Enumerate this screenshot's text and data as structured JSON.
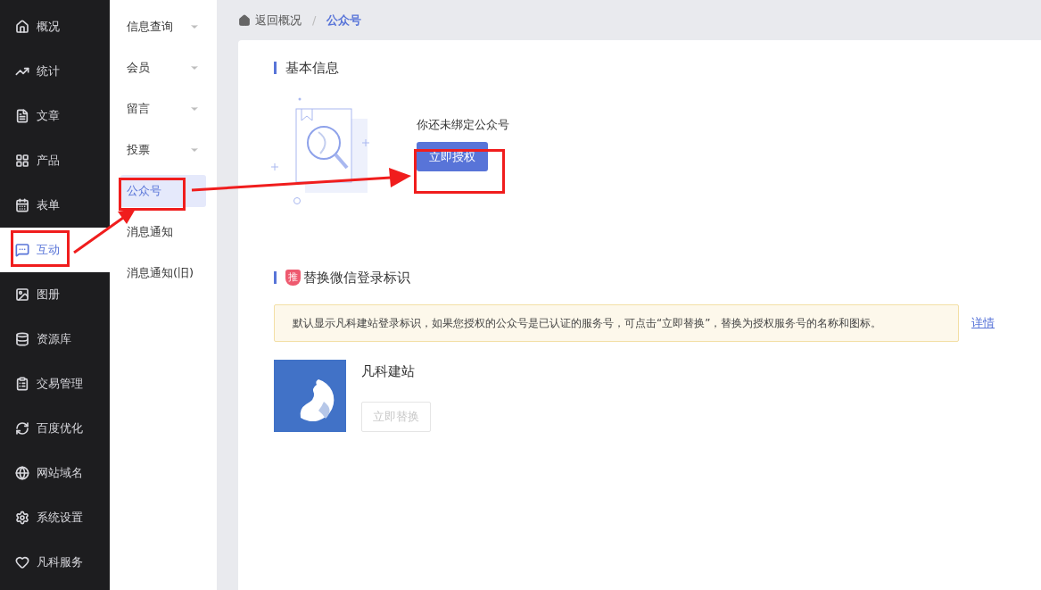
{
  "main_nav": [
    {
      "label": "概况",
      "selected": false
    },
    {
      "label": "统计",
      "selected": false
    },
    {
      "label": "文章",
      "selected": false
    },
    {
      "label": "产品",
      "selected": false
    },
    {
      "label": "表单",
      "selected": false
    },
    {
      "label": "互动",
      "selected": true
    },
    {
      "label": "图册",
      "selected": false
    },
    {
      "label": "资源库",
      "selected": false
    },
    {
      "label": "交易管理",
      "selected": false
    },
    {
      "label": "百度优化",
      "selected": false
    },
    {
      "label": "网站域名",
      "selected": false
    },
    {
      "label": "系统设置",
      "selected": false
    },
    {
      "label": "凡科服务",
      "selected": false
    }
  ],
  "sub_nav": [
    {
      "label": "信息查询",
      "expandable": true,
      "selected": false
    },
    {
      "label": "会员",
      "expandable": true,
      "selected": false
    },
    {
      "label": "留言",
      "expandable": true,
      "selected": false
    },
    {
      "label": "投票",
      "expandable": true,
      "selected": false
    },
    {
      "label": "公众号",
      "expandable": false,
      "selected": true
    },
    {
      "label": "消息通知",
      "expandable": false,
      "selected": false
    },
    {
      "label": "消息通知(旧)",
      "expandable": false,
      "selected": false
    }
  ],
  "breadcrumb": {
    "back": "返回概况",
    "separator": "/",
    "current": "公众号"
  },
  "basic_info": {
    "title": "基本信息",
    "message": "你还未绑定公众号",
    "button": "立即授权"
  },
  "replace_login": {
    "badge": "推",
    "title": "替换微信登录标识",
    "notice": "默认显示凡科建站登录标识，如果您授权的公众号是已认证的服务号，可点击“立即替换”，替换为授权服务号的名称和图标。",
    "link": "详情",
    "site_name": "凡科建站",
    "button": {
      "label": "立即替换",
      "disabled": true
    }
  }
}
